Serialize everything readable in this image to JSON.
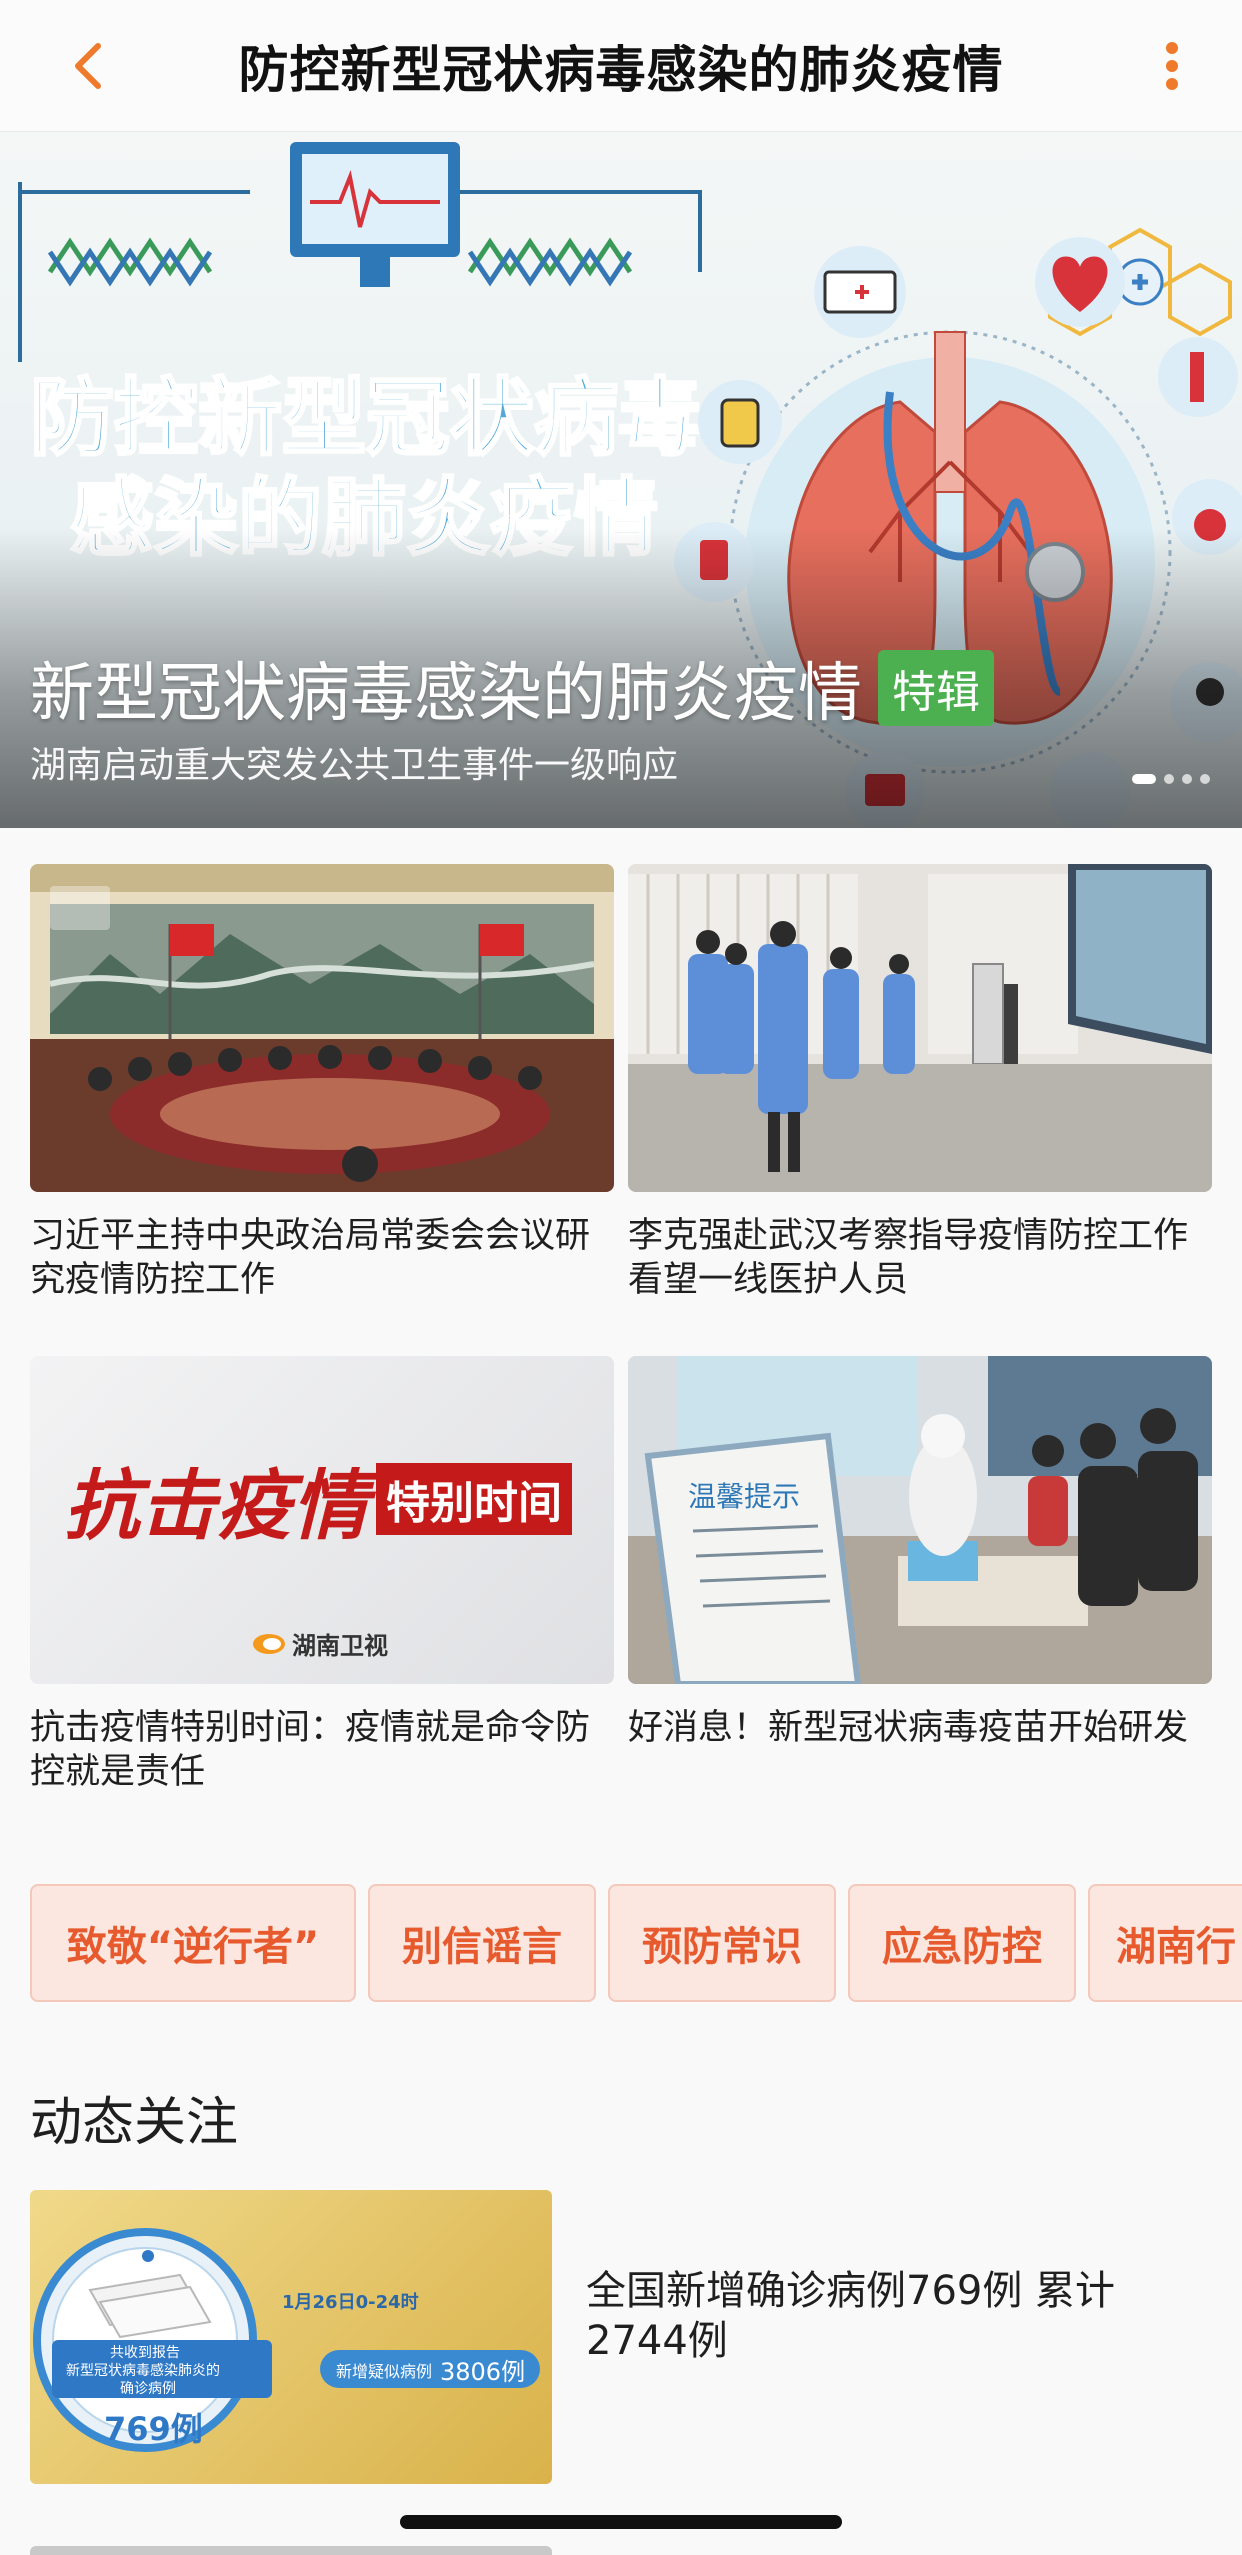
{
  "header": {
    "title": "防控新型冠状病毒感染的肺炎疫情",
    "back_icon": "chevron-left-icon",
    "more_icon": "vertical-dots-icon",
    "accent_color": "#f07a2b"
  },
  "banner": {
    "art_text_line1": "防控新型冠状病毒",
    "art_text_line2": "感染的肺炎疫情",
    "title": "新型冠状病毒感染的肺炎疫情",
    "badge": "特辑",
    "subtitle": "湖南启动重大突发公共卫生事件一级响应",
    "slide_count": 4,
    "active_slide": 1
  },
  "news": [
    {
      "caption": "习近平主持中央政治局常委会会议研究疫情防控工作"
    },
    {
      "caption": "李克强赴武汉考察指导疫情防控工作 看望一线医护人员"
    },
    {
      "caption": "抗击疫情特别时间：疫情就是命令防控就是责任",
      "thumb_text_main": "抗击疫情",
      "thumb_text_tag": "特别时间",
      "thumb_logo": "湖南卫视"
    },
    {
      "caption": "好消息！新型冠状病毒疫苗开始研发",
      "thumb_sign": "温馨提示"
    }
  ],
  "tags": [
    "致敬“逆行者”",
    "别信谣言",
    "预防常识",
    "应急防控",
    "湖南行"
  ],
  "section": {
    "title": "动态关注"
  },
  "dynamic": [
    {
      "text": "全国新增确诊病例769例 累计2744例",
      "thumb": {
        "date": "1月26日0-24时",
        "circle_line1": "共收到报告",
        "circle_line2": "新型冠状病毒感染肺炎的",
        "circle_line3": "确诊病例",
        "confirmed": "769例",
        "suspect_label": "新增疑似病例",
        "suspect_value": "3806例"
      }
    }
  ]
}
